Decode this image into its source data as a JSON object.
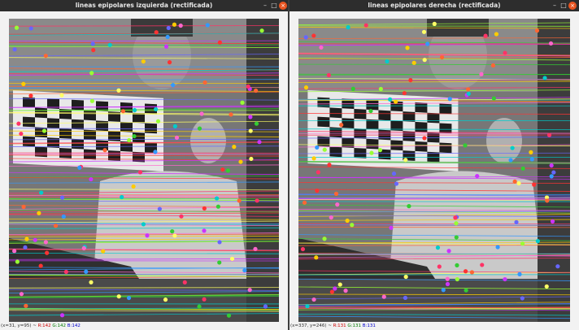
{
  "windows": [
    {
      "id": "left",
      "title": "lineas epipolares izquierda (rectificada)",
      "status": {
        "coords": "(x=31, y=95) ~",
        "r": "R:142",
        "g": "G:142",
        "b": "B:142"
      },
      "controls": {
        "minimize": "–",
        "maximize": "□",
        "close": "×"
      }
    },
    {
      "id": "right",
      "title": "lineas epipolares derecha (rectificada)",
      "status": {
        "coords": "(x=337, y=246) ~",
        "r": "R:131",
        "g": "G:131",
        "b": "B:131"
      },
      "controls": {
        "minimize": "–",
        "maximize": "□",
        "close": "×"
      }
    }
  ],
  "colors": {
    "titlebar": "#2d2d2d",
    "close_button": "#e95420",
    "window_bg": "#f2f2f2",
    "epipolar_palette": [
      "#ff3366",
      "#33cc33",
      "#ffcc00",
      "#3399ff",
      "#cc33ff",
      "#ff6633",
      "#00cccc",
      "#99ff33",
      "#ff66cc",
      "#6666ff",
      "#ffff66",
      "#ff3333"
    ]
  },
  "icons": [
    "minimize-icon",
    "maximize-icon",
    "close-icon"
  ]
}
